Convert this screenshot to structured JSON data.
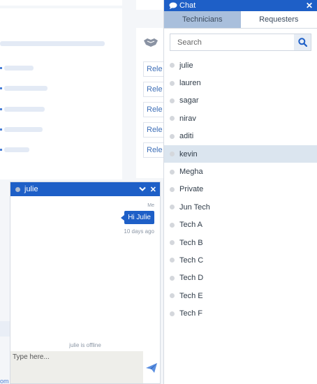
{
  "background": {
    "release_labels": [
      "Rele",
      "Rele",
      "Rele",
      "Rele",
      "Rele"
    ],
    "footer_fragment": "om"
  },
  "chat_panel": {
    "title": "Chat",
    "tabs": [
      {
        "label": "Technicians",
        "active": true
      },
      {
        "label": "Requesters",
        "active": false
      }
    ],
    "search": {
      "placeholder": "Search",
      "value": ""
    },
    "contacts": [
      {
        "name": "julie",
        "status": "offline",
        "selected": false
      },
      {
        "name": "lauren",
        "status": "offline",
        "selected": false
      },
      {
        "name": "sagar",
        "status": "offline",
        "selected": false
      },
      {
        "name": "nirav",
        "status": "offline",
        "selected": false
      },
      {
        "name": "aditi",
        "status": "offline",
        "selected": false
      },
      {
        "name": "kevin",
        "status": "offline",
        "selected": true
      },
      {
        "name": "Megha",
        "status": "offline",
        "selected": false
      },
      {
        "name": "Private",
        "status": "offline",
        "selected": false
      },
      {
        "name": "Jun Tech",
        "status": "offline",
        "selected": false
      },
      {
        "name": "Tech A",
        "status": "offline",
        "selected": false
      },
      {
        "name": "Tech B",
        "status": "offline",
        "selected": false
      },
      {
        "name": "Tech C",
        "status": "offline",
        "selected": false
      },
      {
        "name": "Tech D",
        "status": "offline",
        "selected": false
      },
      {
        "name": "Tech E",
        "status": "offline",
        "selected": false
      },
      {
        "name": "Tech F",
        "status": "offline",
        "selected": false
      }
    ]
  },
  "chat_window": {
    "contact_name": "julie",
    "messages": [
      {
        "sender": "Me",
        "text": "Hi Julie",
        "time": "10 days ago"
      }
    ],
    "status_note": "julie is offline",
    "compose": {
      "placeholder": "Type here...",
      "value": ""
    }
  },
  "colors": {
    "brand": "#1e5fc7",
    "tab_active": "#a9bfdc",
    "selected_row": "#dbe5ef",
    "status_offline": "#d4d7dc"
  },
  "icons": {
    "chat_bubble": "chat-bubble-icon",
    "close": "close-icon",
    "search": "search-icon",
    "minimize": "chevron-down-icon",
    "send": "paper-plane-icon"
  }
}
